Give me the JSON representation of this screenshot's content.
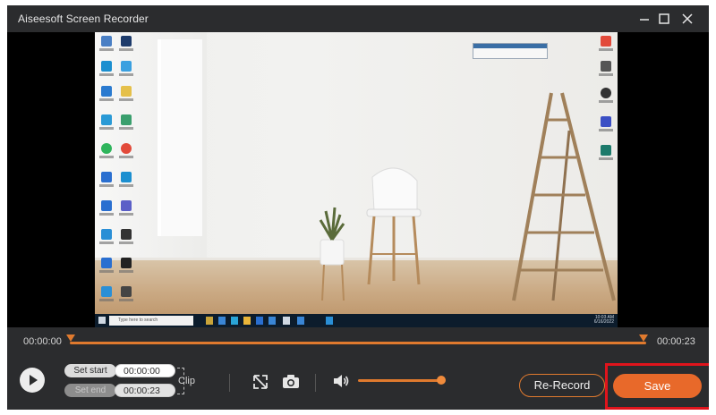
{
  "window": {
    "title": "Aiseesoft Screen Recorder",
    "controls": [
      "minimize-icon",
      "maximize-icon",
      "close-icon"
    ]
  },
  "preview": {
    "taskbar_search_placeholder": "Type here to search",
    "taskbar_clock": [
      "10:03 AM",
      "6/16/2022"
    ]
  },
  "timeline": {
    "start_time": "00:00:00",
    "end_time": "00:00:23",
    "accent_color": "#e07a2e"
  },
  "clip": {
    "set_start_label": "Set start",
    "set_start_value": "00:00:00",
    "set_end_label": "Set end",
    "set_end_value": "00:00:23",
    "clip_label": "Clip"
  },
  "tools": {
    "expand_icon": "expand-icon",
    "snapshot_icon": "camera-icon",
    "volume_icon": "volume-icon",
    "volume_level": 0.95
  },
  "actions": {
    "rerecord_label": "Re-Record",
    "save_label": "Save",
    "save_color": "#e8692a",
    "highlight_color": "#e0141c"
  }
}
